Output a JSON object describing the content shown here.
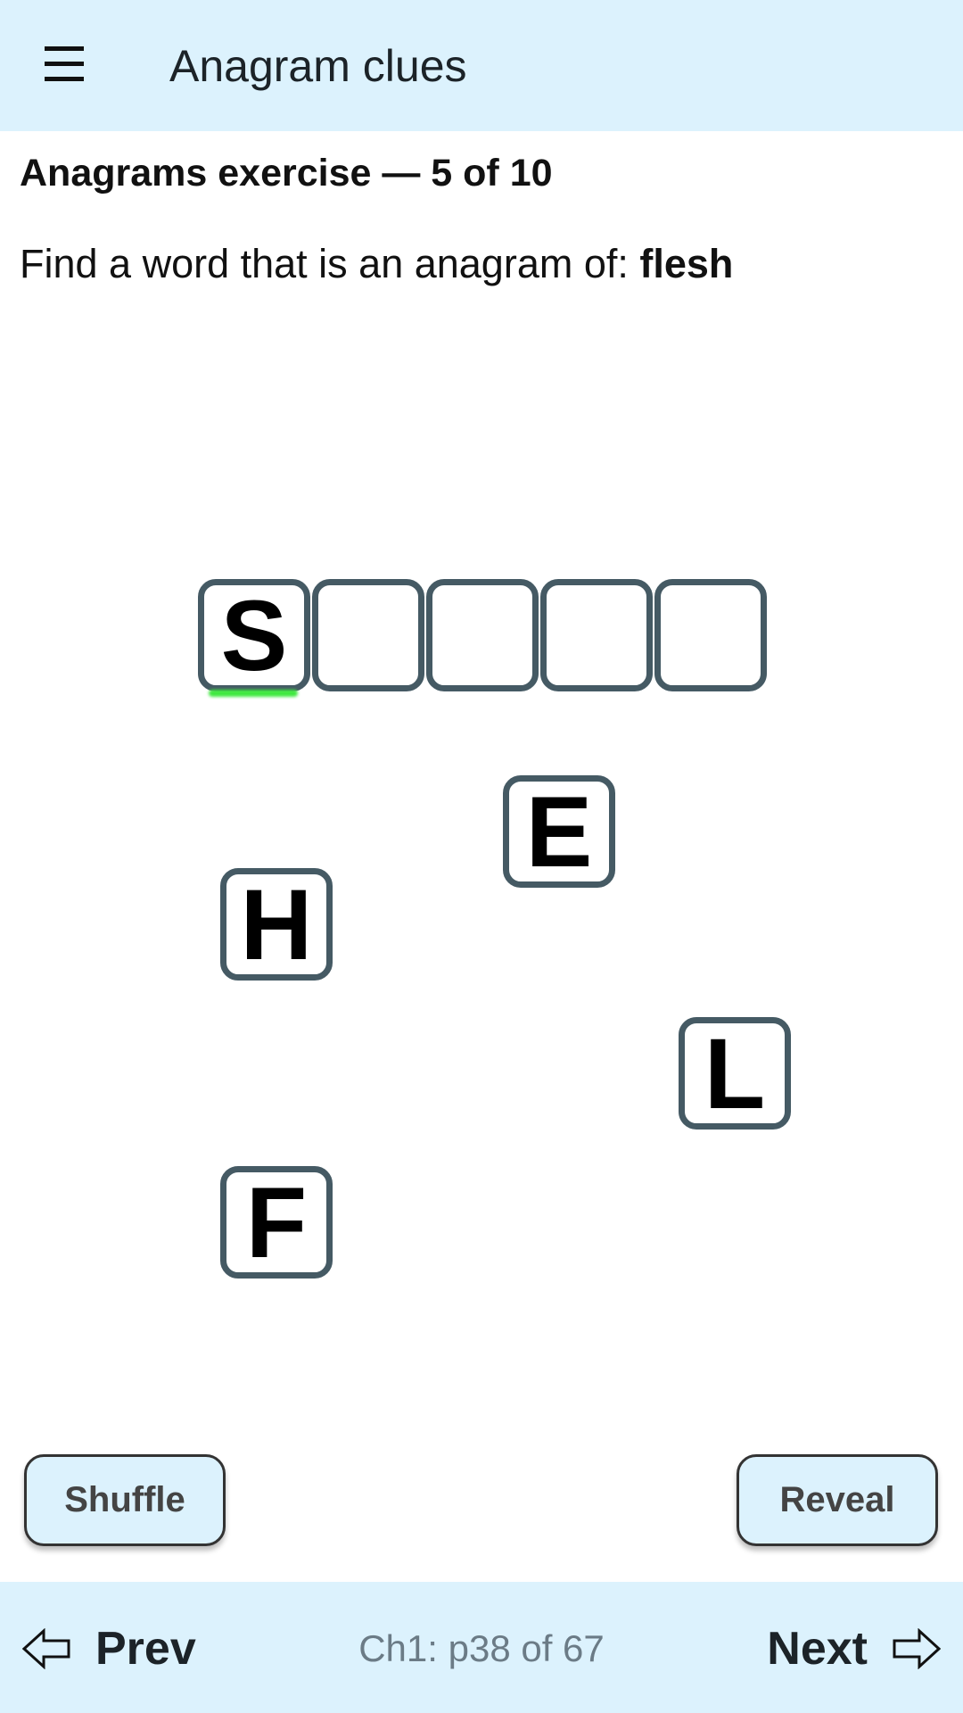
{
  "appbar": {
    "title": "Anagram clues",
    "menu_icon": "hamburger-menu-icon"
  },
  "exercise": {
    "heading": "Anagrams exercise — 5 of 10",
    "prompt_prefix": "Find a word that is an anagram of: ",
    "prompt_word": "flesh",
    "slots": [
      "S",
      "",
      "",
      "",
      ""
    ],
    "active_slot_indicator_color": "#3ee83e",
    "tiles": [
      "E",
      "H",
      "L",
      "F"
    ]
  },
  "buttons": {
    "shuffle": "Shuffle",
    "reveal": "Reveal"
  },
  "footer": {
    "prev": "Prev",
    "next": "Next",
    "page_info": "Ch1: p38 of 67",
    "prev_icon": "arrow-left-outline-icon",
    "next_icon": "arrow-right-outline-icon"
  },
  "colors": {
    "bar_background": "#dcf2fd",
    "tile_border": "#455a64"
  }
}
